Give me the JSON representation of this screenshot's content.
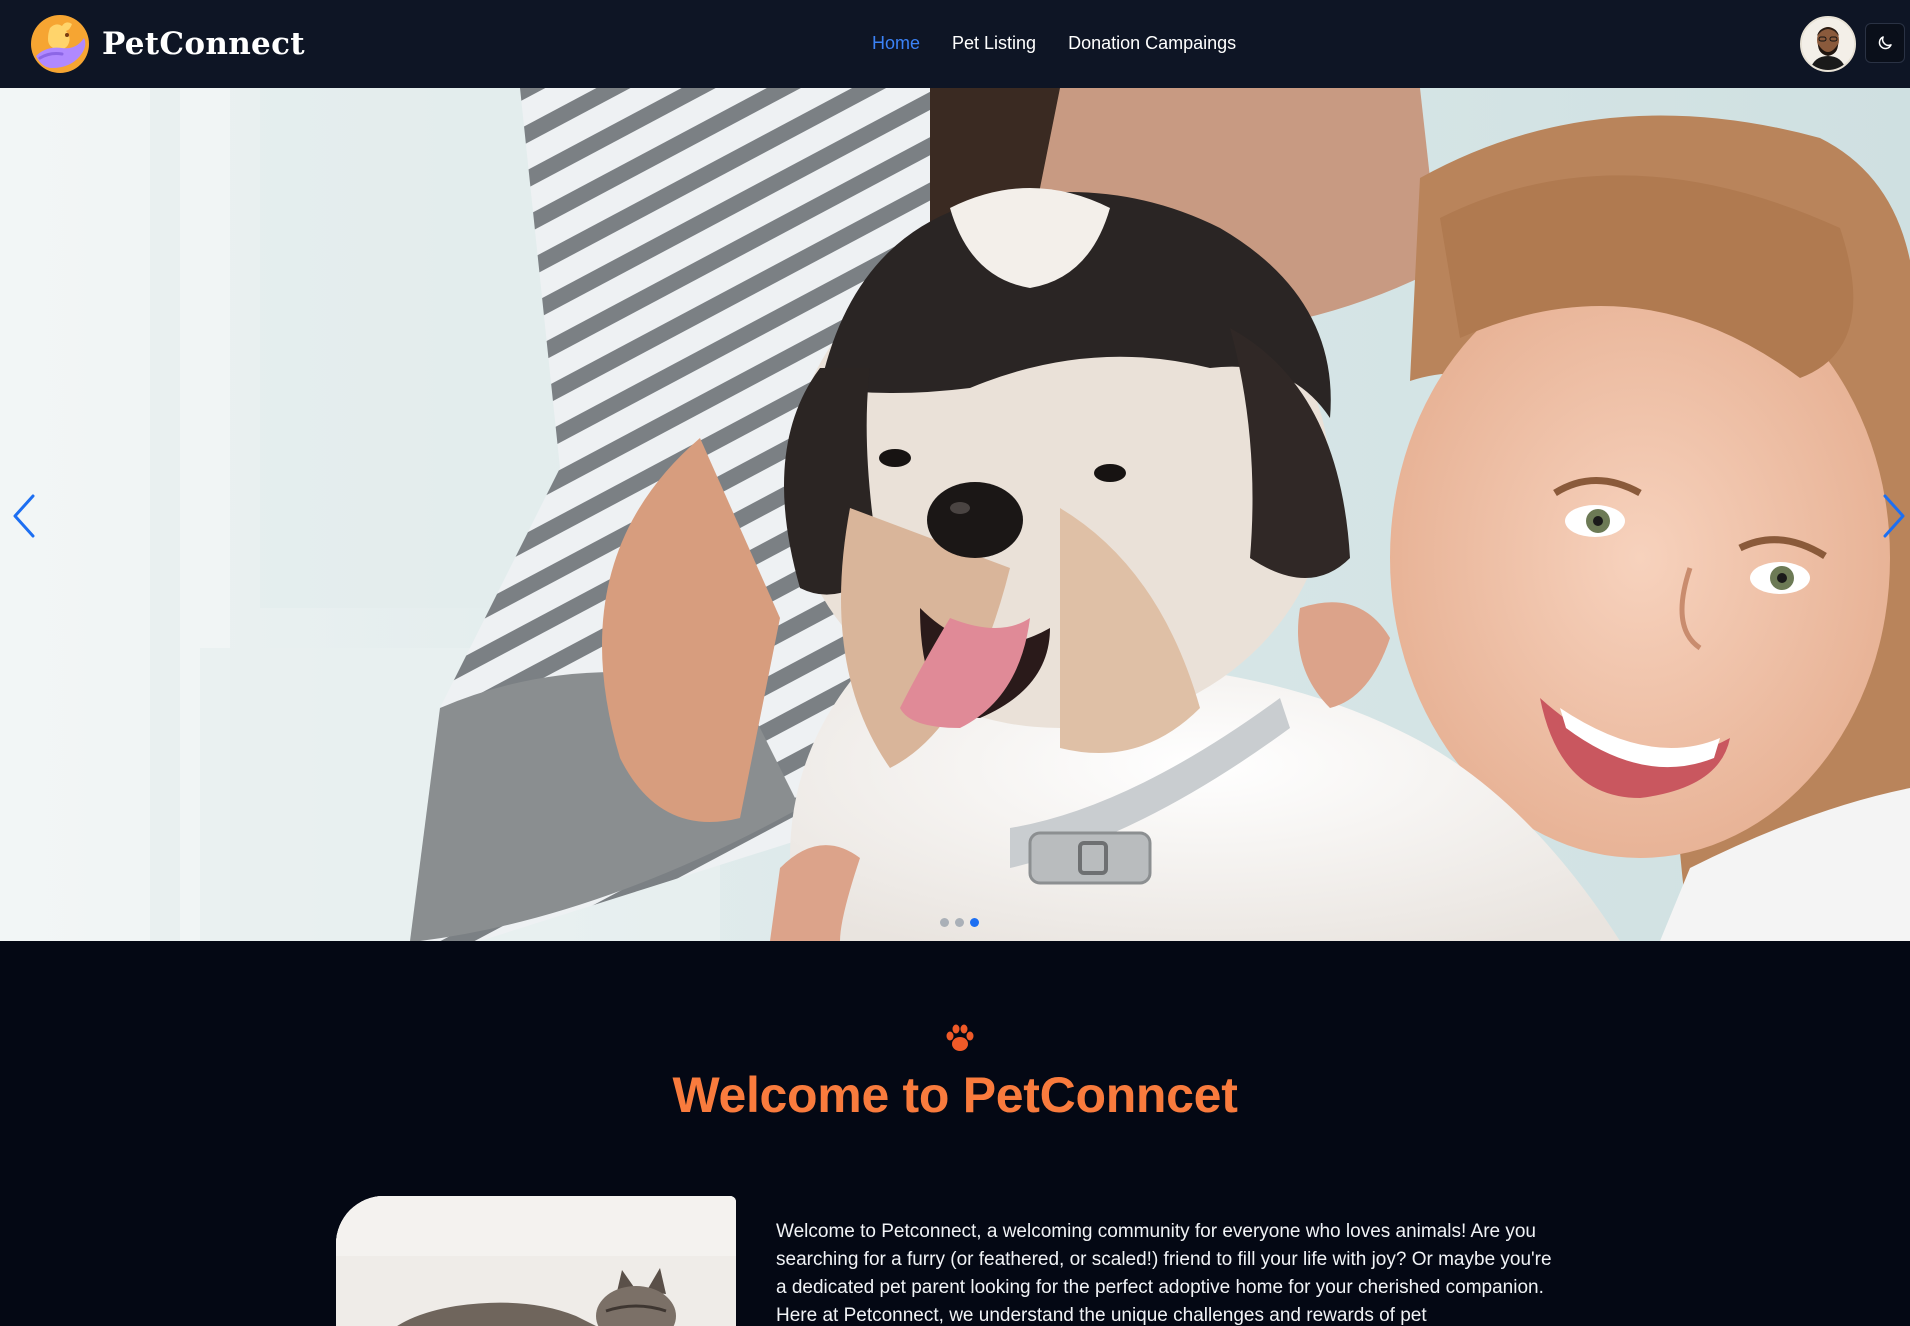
{
  "brand": {
    "name": "PetConnect",
    "logo_icon": "pet-hand-logo-icon"
  },
  "nav": {
    "items": [
      {
        "label": "Home",
        "active": true
      },
      {
        "label": "Pet Listing",
        "active": false
      },
      {
        "label": "Donation Campaings",
        "active": false
      }
    ]
  },
  "header_actions": {
    "avatar_icon": "user-avatar",
    "theme_icon": "moon-icon"
  },
  "hero": {
    "prev_icon": "chevron-left-icon",
    "next_icon": "chevron-right-icon",
    "slide_count": 3,
    "active_slide": 3,
    "arrow_color": "#1d6ff2"
  },
  "welcome": {
    "icon": "paw-icon",
    "title": "Welcome to PetConncet",
    "body": "Welcome to Petconnect, a welcoming community for everyone who loves animals! Are you searching for a furry (or feathered, or scaled!) friend to fill your life with joy? Or maybe you're a dedicated pet parent looking for the perfect adoptive home for your cherished companion. Here at Petconnect, we understand the unique challenges and rewards of pet"
  },
  "colors": {
    "page_bg": "#040814",
    "nav_bg": "#0e1525",
    "accent_blue": "#3b82f6",
    "title_orange": "#f97b3d"
  }
}
